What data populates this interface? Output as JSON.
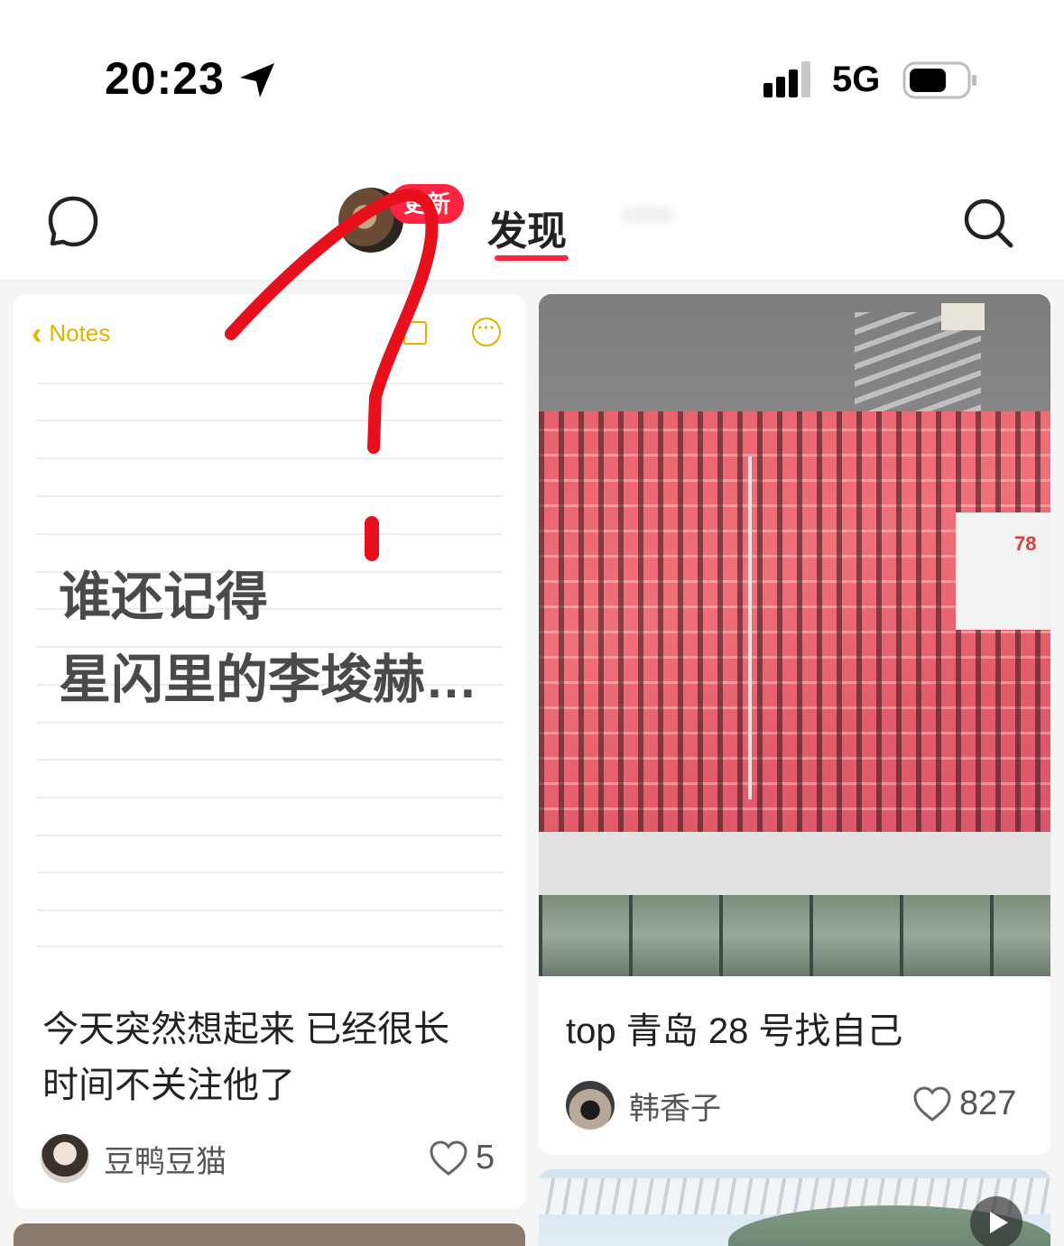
{
  "status_bar": {
    "time": "20:23",
    "network": "5G"
  },
  "header": {
    "avatar_badge": "更新",
    "active_tab": "发现"
  },
  "feed": {
    "left_card": {
      "cover": {
        "back_label": "Notes",
        "text_line1": "谁还记得",
        "text_line2": "星闪里的李埈赫…"
      },
      "title_line1": "今天突然想起来 已经很长",
      "title_line2": "时间不关注他了",
      "author": "豆鸭豆猫",
      "likes": "5"
    },
    "right_card": {
      "exit_sign": "78",
      "title": "top 青岛 28 号找自己",
      "author": "韩香子",
      "likes": "827"
    }
  },
  "colors": {
    "accent": "#ff2442",
    "notes_yellow": "#e2b100"
  }
}
